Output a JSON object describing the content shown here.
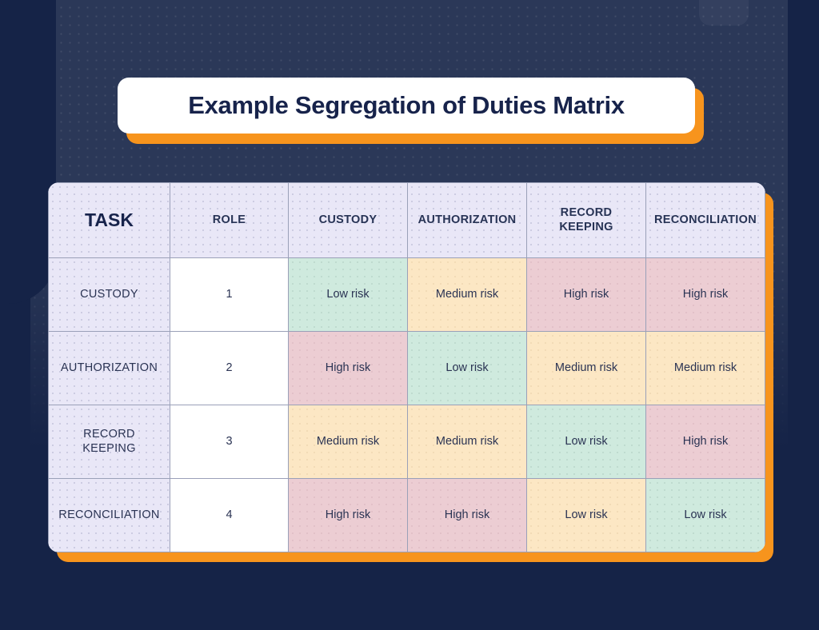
{
  "page": {
    "title": "Example Segregation of Duties Matrix",
    "background_color": "#152347",
    "panel_color": "#2b3858",
    "accent_color": "#f7941d",
    "card_color": "#ffffff",
    "header_cell_color": "#e9e7f7",
    "low_risk_color": "#cfeade",
    "medium_risk_color": "#fce7c4",
    "high_risk_color": "#eccdd3"
  },
  "chart_data": {
    "type": "table",
    "title": "Example Segregation of Duties Matrix",
    "columns": [
      "TASK",
      "ROLE",
      "CUSTODY",
      "AUTHORIZATION",
      "RECORD KEEPING",
      "RECONCILIATION"
    ],
    "column_lines": [
      [
        "TASK"
      ],
      [
        "ROLE"
      ],
      [
        "CUSTODY"
      ],
      [
        "AUTHORIZATION"
      ],
      [
        "RECORD",
        "KEEPING"
      ],
      [
        "RECONCILIATION"
      ]
    ],
    "rows": [
      {
        "task_lines": [
          "CUSTODY"
        ],
        "task": "CUSTODY",
        "role": "1",
        "cells": [
          {
            "label": "Low risk",
            "level": "low"
          },
          {
            "label": "Medium risk",
            "level": "medium"
          },
          {
            "label": "High risk",
            "level": "high"
          },
          {
            "label": "High risk",
            "level": "high"
          }
        ]
      },
      {
        "task_lines": [
          "AUTHORIZATION"
        ],
        "task": "AUTHORIZATION",
        "role": "2",
        "cells": [
          {
            "label": "High risk",
            "level": "high"
          },
          {
            "label": "Low risk",
            "level": "low"
          },
          {
            "label": "Medium risk",
            "level": "medium"
          },
          {
            "label": "Medium risk",
            "level": "medium"
          }
        ]
      },
      {
        "task_lines": [
          "RECORD",
          "KEEPING"
        ],
        "task": "RECORD KEEPING",
        "role": "3",
        "cells": [
          {
            "label": "Medium risk",
            "level": "medium"
          },
          {
            "label": "Medium risk",
            "level": "medium"
          },
          {
            "label": "Low risk",
            "level": "low"
          },
          {
            "label": "High risk",
            "level": "high"
          }
        ]
      },
      {
        "task_lines": [
          "RECONCILIATION"
        ],
        "task": "RECONCILIATION",
        "role": "4",
        "cells": [
          {
            "label": "High risk",
            "level": "high"
          },
          {
            "label": "High risk",
            "level": "high"
          },
          {
            "label": "Low risk",
            "level": "medium"
          },
          {
            "label": "Low risk",
            "level": "low"
          }
        ]
      }
    ]
  }
}
